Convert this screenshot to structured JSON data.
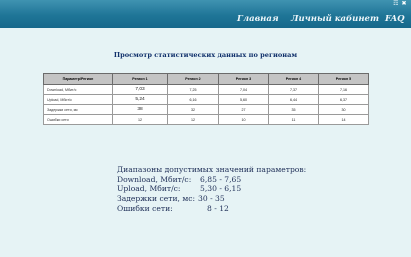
{
  "header": {
    "icons": "☶ ✖",
    "nav": {
      "home": "Главная",
      "cabinet": "Личный кабинет",
      "faq": "FAQ"
    }
  },
  "page": {
    "title": "Просмотр статистических данных по регионам"
  },
  "table": {
    "headers": [
      "Параметр\\Регион",
      "Регион 1",
      "Регион 2",
      "Регион 3",
      "Регион 4",
      "Регион 5"
    ],
    "rows": [
      [
        "Download, Мбит/с",
        "7,03",
        "7,25",
        "7,04",
        "7,37",
        "7,16"
      ],
      [
        "Upload, Мбит/с",
        "5,24",
        "6,16",
        "5,60",
        "6,44",
        "6,37"
      ],
      [
        "Задержки сети, мс",
        "38",
        "32",
        "27",
        "35",
        "30"
      ],
      [
        "Ошибки сети",
        "12",
        "12",
        "10",
        "11",
        "14"
      ]
    ]
  },
  "ranges": {
    "heading": "Диапазоны допустимых значений параметров:",
    "items": [
      {
        "label": "Download, Мбит/с:",
        "value": "6,85 - 7,65"
      },
      {
        "label": "Upload, Мбит/с:",
        "value": "5,30 - 6,15"
      },
      {
        "label": "Задержки сети, мс:",
        "value": "30 - 35"
      },
      {
        "label": "Ошибки сети:",
        "value": "8 - 12"
      }
    ]
  }
}
